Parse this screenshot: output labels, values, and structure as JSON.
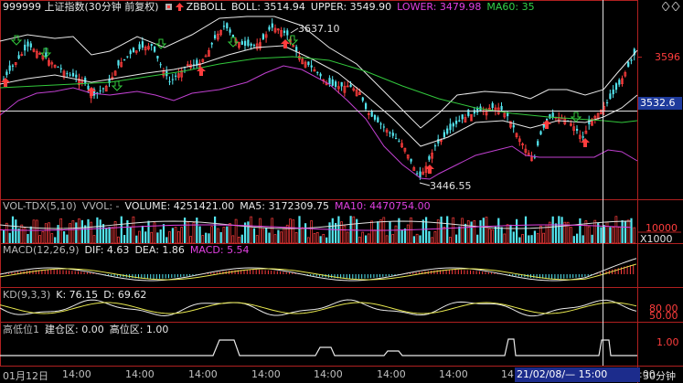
{
  "main": {
    "title": "999999 上证指数(30分钟 前复权)",
    "indicator": "ZBBOLL",
    "boll_label": "BOLL: 3514.94",
    "upper_label": "UPPER: 3549.90",
    "lower_label": "LOWER: 3479.98",
    "ma60_label": "MA60: 35",
    "axis_top": "3596",
    "axis_current": "3532.6",
    "high_annotation": "3637.10",
    "low_annotation": "3446.55"
  },
  "volume": {
    "name": "VOL-TDX(5,10)",
    "vvol": "VVOL: -",
    "volume_label": "VOLUME: 4251421.00",
    "ma5_label": "MA5: 3172309.75",
    "ma10_label": "MA10: 4470754.00",
    "axis_value": "10000",
    "axis_unit": "X1000"
  },
  "macd": {
    "name": "MACD(12,26,9)",
    "dif_label": "DIF: 4.63",
    "dea_label": "DEA: 1.86",
    "macd_label": "MACD: 5.54"
  },
  "kd": {
    "name": "KD(9,3,3)",
    "k_label": "K: 76.15",
    "d_label": "D: 69.62",
    "axis_high": "80.00",
    "axis_low": "50.00"
  },
  "custom": {
    "name": "高低位1",
    "build_label": "建仓区: 0.00",
    "high_label": "高位区: 1.00",
    "axis_value": "1.00"
  },
  "time_axis": {
    "labels": [
      "01月12日",
      "14:00",
      "14:00",
      "14:00",
      "14:00",
      "14:00",
      "14:00",
      "14:00",
      "14:00",
      "14:00"
    ],
    "cursor_time": "21/02/08/— 15:00",
    "period": "30分钟"
  },
  "colors": {
    "bg": "#000000",
    "up": "#ff3d3d",
    "down": "#54e6f0",
    "boll_mid": "#e8e8e8",
    "upper_band": "#e8e8e8",
    "lower_band": "#c040d0",
    "ma60": "#32c83c"
  }
}
